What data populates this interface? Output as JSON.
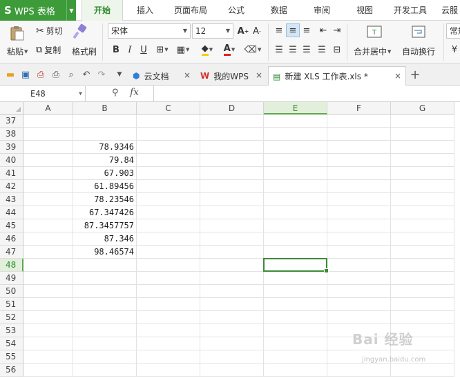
{
  "app": {
    "name": "WPS 表格",
    "logo": "S"
  },
  "menu_tabs": [
    "开始",
    "插入",
    "页面布局",
    "公式",
    "数据",
    "审阅",
    "视图",
    "开发工具",
    "云服"
  ],
  "active_menu_tab": "开始",
  "ribbon": {
    "paste_label": "粘贴",
    "cut_label": "剪切",
    "copy_label": "复制",
    "format_painter_label": "格式刷",
    "font_name": "宋体",
    "font_size": "12",
    "merge_center_label": "合并居中",
    "wrap_text_label": "自动换行",
    "number_format_label": "常规"
  },
  "doc_tabs": [
    {
      "label": "云文档",
      "icon": "cloud-docs-icon"
    },
    {
      "label": "我的WPS",
      "icon": "wps-logo-icon"
    },
    {
      "label": "新建 XLS 工作表.xls *",
      "icon": "xls-file-icon",
      "active": true
    }
  ],
  "formula_bar": {
    "cell_ref": "E48",
    "fx_label": "fx",
    "formula": ""
  },
  "sheet": {
    "columns": [
      "A",
      "B",
      "C",
      "D",
      "E",
      "F",
      "G"
    ],
    "selected_column": "E",
    "rows": [
      {
        "num": "37",
        "B": ""
      },
      {
        "num": "38",
        "B": ""
      },
      {
        "num": "39",
        "B": "78.9346"
      },
      {
        "num": "40",
        "B": "79.84"
      },
      {
        "num": "41",
        "B": "67.903"
      },
      {
        "num": "42",
        "B": "61.89456"
      },
      {
        "num": "43",
        "B": "78.23546"
      },
      {
        "num": "44",
        "B": "67.347426"
      },
      {
        "num": "45",
        "B": "87.3457757"
      },
      {
        "num": "46",
        "B": "87.346"
      },
      {
        "num": "47",
        "B": "98.46574"
      },
      {
        "num": "48",
        "B": ""
      },
      {
        "num": "49",
        "B": ""
      },
      {
        "num": "50",
        "B": ""
      },
      {
        "num": "51",
        "B": ""
      },
      {
        "num": "52",
        "B": ""
      },
      {
        "num": "53",
        "B": ""
      },
      {
        "num": "54",
        "B": ""
      },
      {
        "num": "55",
        "B": ""
      },
      {
        "num": "56",
        "B": ""
      }
    ],
    "selected_row": "48"
  },
  "watermark": {
    "text": "Bai 经验",
    "sub": "jingyan.baidu.com"
  },
  "colors": {
    "accent": "#3d9b3a",
    "selection": "#3d8b37"
  }
}
